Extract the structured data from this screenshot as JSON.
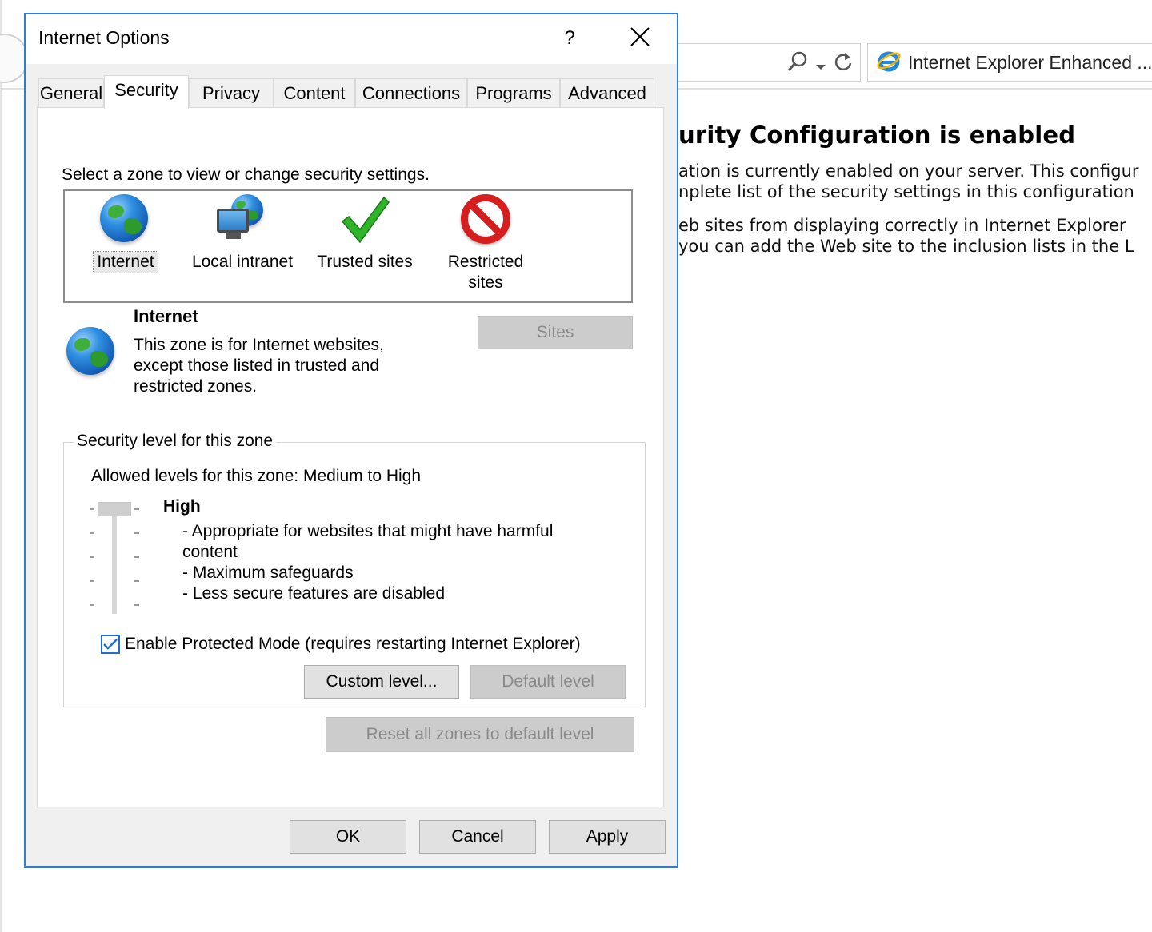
{
  "browser": {
    "tab_title": "Internet Explorer Enhanced ...",
    "page_heading": "urity Configuration is enabled",
    "page_lines": [
      "ation is currently enabled on your server. This configur",
      "nplete list of the security settings in this configuration",
      "eb sites from displaying correctly in Internet Explorer",
      "you can add the Web site to the inclusion lists in the L"
    ]
  },
  "dialog": {
    "title": "Internet Options",
    "help_label": "?",
    "close_label": "✕",
    "tabs": [
      "General",
      "Security",
      "Privacy",
      "Content",
      "Connections",
      "Programs",
      "Advanced"
    ],
    "active_tab": "Security",
    "zone_prompt": "Select a zone to view or change security settings.",
    "zones": [
      {
        "label": "Internet",
        "icon": "globe-icon"
      },
      {
        "label": "Local intranet",
        "icon": "intranet-icon"
      },
      {
        "label": "Trusted sites",
        "icon": "checkmark-icon"
      },
      {
        "label": "Restricted sites",
        "icon": "restricted-icon"
      }
    ],
    "selected_zone": {
      "name": "Internet",
      "description": "This zone is for Internet websites, except those listed in trusted and restricted zones."
    },
    "sites_button": "Sites",
    "security_level": {
      "legend": "Security level for this zone",
      "allowed": "Allowed levels for this zone: Medium to High",
      "level_name": "High",
      "level_position": 1.0,
      "bullets": [
        "- Appropriate for websites that might have harmful content",
        "- Maximum safeguards",
        "- Less secure features are disabled"
      ],
      "protected_mode_label": "Enable Protected Mode (requires restarting Internet Explorer)",
      "protected_mode_checked": true,
      "custom_level_button": "Custom level...",
      "default_level_button": "Default level"
    },
    "reset_all_button": "Reset all zones to default level",
    "ok_button": "OK",
    "cancel_button": "Cancel",
    "apply_button": "Apply"
  },
  "colors": {
    "dialog_border": "#2b7fd2",
    "checkbox_accent": "#1f6fd0",
    "restricted_red": "#d71e1e",
    "trusted_green": "#2fb42a"
  }
}
